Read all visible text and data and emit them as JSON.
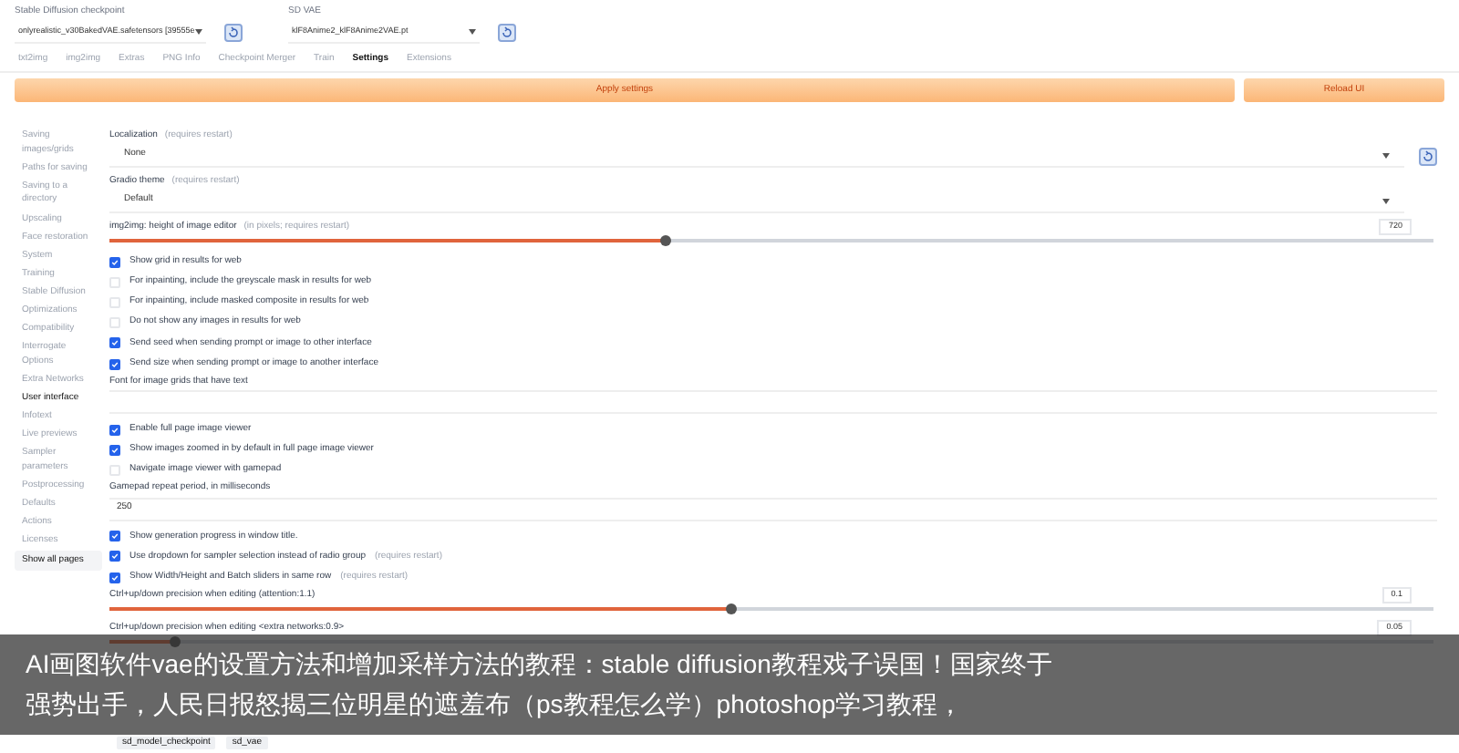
{
  "top_fields": [
    {
      "label": "Stable Diffusion checkpoint",
      "value": "onlyrealistic_v30BakedVAE.safetensors [39555e"
    },
    {
      "label": "SD VAE",
      "value": "klF8Anime2_klF8Anime2VAE.pt"
    }
  ],
  "tabs": [
    {
      "label": "txt2img",
      "selected": false
    },
    {
      "label": "img2img",
      "selected": false
    },
    {
      "label": "Extras",
      "selected": false
    },
    {
      "label": "PNG Info",
      "selected": false
    },
    {
      "label": "Checkpoint Merger",
      "selected": false
    },
    {
      "label": "Train",
      "selected": false
    },
    {
      "label": "Settings",
      "selected": true
    },
    {
      "label": "Extensions",
      "selected": false
    }
  ],
  "buttons": [
    {
      "label": "Apply settings"
    },
    {
      "label": "Reload UI"
    }
  ],
  "sidebar": {
    "items": [
      {
        "label": "Saving images/grids",
        "selected": false
      },
      {
        "label": "Paths for saving",
        "selected": false
      },
      {
        "label": "Saving to a directory",
        "selected": false
      },
      {
        "label": "Upscaling",
        "selected": false
      },
      {
        "label": "Face restoration",
        "selected": false
      },
      {
        "label": "System",
        "selected": false
      },
      {
        "label": "Training",
        "selected": false
      },
      {
        "label": "Stable Diffusion",
        "selected": false
      },
      {
        "label": "Optimizations",
        "selected": false
      },
      {
        "label": "Compatibility",
        "selected": false
      },
      {
        "label": "Interrogate Options",
        "selected": false
      },
      {
        "label": "Extra Networks",
        "selected": false
      },
      {
        "label": "User interface",
        "selected": true
      },
      {
        "label": "Infotext",
        "selected": false
      },
      {
        "label": "Live previews",
        "selected": false
      },
      {
        "label": "Sampler parameters",
        "selected": false
      },
      {
        "label": "Postprocessing",
        "selected": false
      },
      {
        "label": "Defaults",
        "selected": false
      },
      {
        "label": "Actions",
        "selected": false
      },
      {
        "label": "Licenses",
        "selected": false
      }
    ],
    "show_all": {
      "label": "Show all pages"
    }
  },
  "settings": [
    {
      "kind": "dropdown",
      "label": "Localization",
      "note": "(requires restart)",
      "value": "None",
      "refresh": true
    },
    {
      "kind": "dropdown",
      "label": "Gradio theme",
      "note": "(requires restart)",
      "value": "Default",
      "refresh": false
    },
    {
      "kind": "slider",
      "label": "img2img: height of image editor",
      "note": "(in pixels; requires restart)",
      "level": 0.42,
      "reading": "720"
    },
    {
      "kind": "checkbox",
      "label": "Show grid in results for web",
      "checked": true
    },
    {
      "kind": "checkbox",
      "label": "For inpainting, include the greyscale mask in results for web",
      "checked": false
    },
    {
      "kind": "checkbox",
      "label": "For inpainting, include masked composite in results for web",
      "checked": false
    },
    {
      "kind": "checkbox",
      "label": "Do not show any images in results for web",
      "checked": false
    },
    {
      "kind": "checkbox",
      "label": "Send seed when sending prompt or image to other interface",
      "checked": true
    },
    {
      "kind": "checkbox",
      "label": "Send size when sending prompt or image to another interface",
      "checked": true
    },
    {
      "kind": "text",
      "label": "Font for image grids that have text"
    },
    {
      "kind": "checkbox",
      "label": "Enable full page image viewer",
      "checked": true
    },
    {
      "kind": "checkbox",
      "label": "Show images zoomed in by default in full page image viewer",
      "checked": true
    },
    {
      "kind": "checkbox",
      "label": "Navigate image viewer with gamepad",
      "checked": false
    },
    {
      "kind": "text",
      "label": "Gamepad repeat period, in milliseconds",
      "value": "250"
    },
    {
      "kind": "checkbox",
      "label": "Show generation progress in window title.",
      "checked": true
    },
    {
      "kind": "checkbox",
      "label": "Use dropdown for sampler selection instead of radio group",
      "note": "(requires restart)",
      "checked": true
    },
    {
      "kind": "checkbox",
      "label": "Show Width/Height and Batch sliders in same row",
      "note": "(requires restart)",
      "checked": true
    },
    {
      "kind": "slider",
      "label": "Ctrl+up/down precision when editing (attention:1.1)",
      "level": 0.47,
      "reading": "0.1"
    },
    {
      "kind": "slider",
      "label": "Ctrl+up/down precision when editing <extra networks:0.9>",
      "level": 0.05,
      "reading": "0.05"
    },
    {
      "kind": "chips",
      "chips": [
        "sd_model_checkpoint",
        "sd_vae"
      ]
    }
  ],
  "caption": [
    "AI画图软件vae的设置方法和增加采样方法的教程：stable diffusion教程戏子误国！国家终于",
    "强势出手，人民日报怒揭三位明星的遮羞布（ps教程怎么学）photoshop学习教程，"
  ]
}
